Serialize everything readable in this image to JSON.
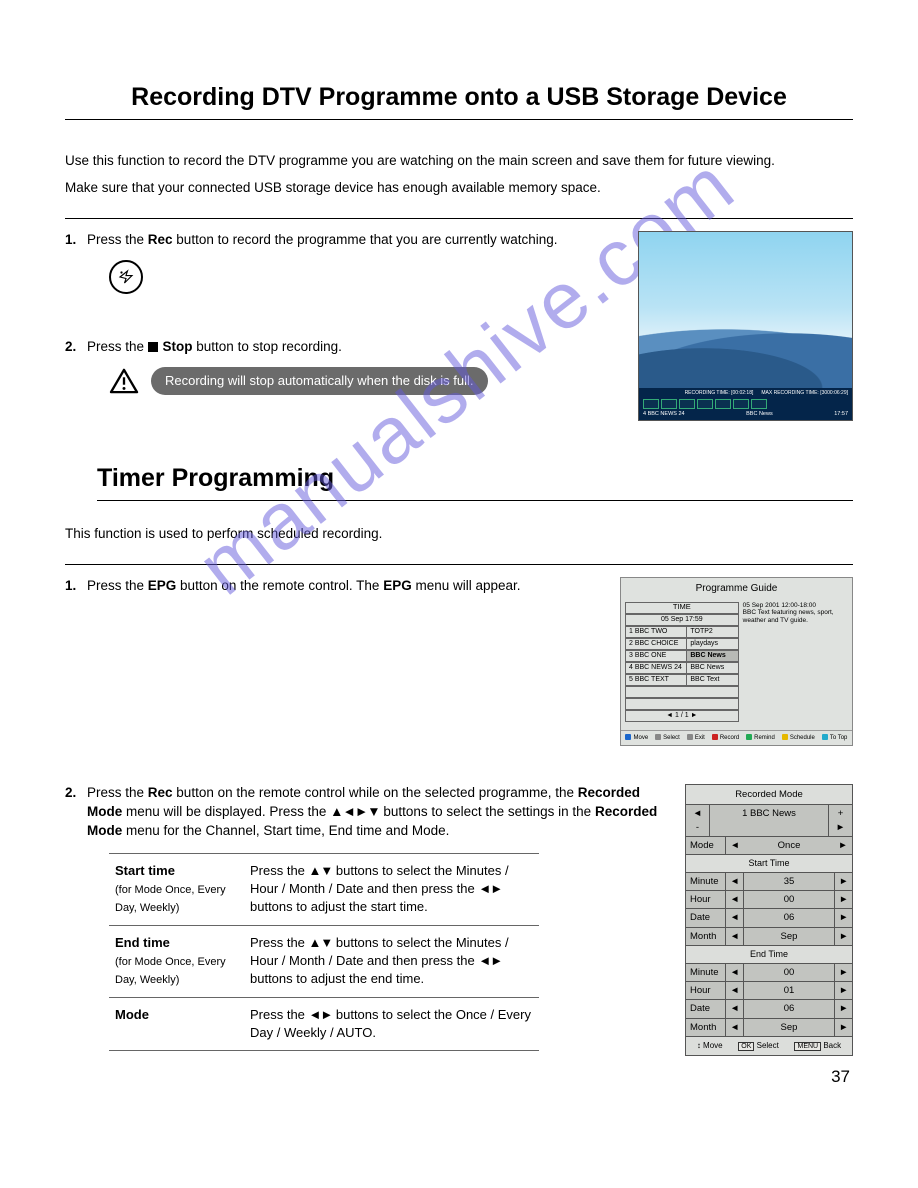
{
  "watermark": "manualshive.com",
  "title1": "Recording DTV Programme onto a USB Storage Device",
  "intro1": "Use this function to record the DTV programme you are watching on the main screen and save them for future viewing.",
  "intro2": "Make sure that your connected USB storage device has enough available memory space.",
  "step1_pre": "Press the ",
  "step1_bold": "Rec",
  "step1_post": " button to record the programme that you are currently watching.",
  "step2_pre": "Press the ",
  "step2_bold": " Stop",
  "step2_post": " button to stop recording.",
  "warning": "Recording will stop automatically when the disk is full.",
  "tv": {
    "rec_time_label": "RECORDING TIME: [00:02:18]",
    "max_time_label": "MAX RECORDING TIME: [3000:06:29]",
    "channel": "4 BBC NEWS 24",
    "prog": "BBC News",
    "time": "17:57"
  },
  "title2": "Timer Programming",
  "intro3": "This function is used to perform scheduled recording.",
  "step3_pre": "Press the ",
  "step3_b1": "EPG",
  "step3_mid": " button on the remote control. The ",
  "step3_b2": "EPG",
  "step3_post": " menu will appear.",
  "epg": {
    "title": "Programme Guide",
    "time_hdr": "TIME",
    "date": "05 Sep   17:59",
    "info_date": "05 Sep 2001       12:00-18:00",
    "info_desc": "BBC Text featuring news, sport, weather and TV guide.",
    "rows": [
      {
        "ch": "1 BBC TWO",
        "pr": "TOTP2"
      },
      {
        "ch": "2 BBC CHOICE",
        "pr": "playdays"
      },
      {
        "ch": "3 BBC ONE",
        "pr": "BBC News"
      },
      {
        "ch": "4 BBC NEWS 24",
        "pr": "BBC News"
      },
      {
        "ch": "5 BBC TEXT",
        "pr": "BBC Text"
      }
    ],
    "page": "◄   1 / 1   ►",
    "legend": [
      {
        "c": "#1a66cc",
        "t": "Move"
      },
      {
        "c": "#888",
        "t": "Select"
      },
      {
        "c": "#888",
        "t": "Exit"
      },
      {
        "c": "#cc2222",
        "t": "Record"
      },
      {
        "c": "#22aa55",
        "t": "Remind"
      },
      {
        "c": "#e6b800",
        "t": "Schedule"
      },
      {
        "c": "#22aacc",
        "t": "To Top"
      }
    ]
  },
  "step4_pre": "Press the ",
  "step4_b1": "Rec",
  "step4_mid1": " button on the remote control while on the selected programme, the ",
  "step4_b2": "Recorded Mode",
  "step4_mid2": " menu will be displayed. Press the ",
  "step4_tri": "▲◄►▼",
  "step4_mid3": " buttons to select the settings in the ",
  "step4_b3": "Recorded Mode",
  "step4_post": " menu for the Channel, Start time, End time and Mode.",
  "settings": [
    {
      "label": "Start time",
      "sub": "(for Mode Once, Every Day, Weekly)",
      "desc_pre": "Press the ",
      "tri1": "▲▼",
      "desc_mid": " buttons to select the Minutes / Hour / Month / Date and then press the ",
      "tri2": "◄►",
      "desc_post": " buttons to adjust the start time."
    },
    {
      "label": "End time",
      "sub": "(for Mode Once, Every Day, Weekly)",
      "desc_pre": "Press the ",
      "tri1": "▲▼",
      "desc_mid": " buttons to select the Minutes / Hour / Month / Date and then press the ",
      "tri2": "◄►",
      "desc_post": " buttons to adjust the end time."
    },
    {
      "label": "Mode",
      "sub": "",
      "desc_pre": "Press the ",
      "tri1": "◄►",
      "desc_mid": " buttons to select the Once / Every Day / Weekly /",
      "tri2": "",
      "desc_post": "AUTO."
    }
  ],
  "rmode": {
    "title": "Recorded Mode",
    "ch_minus": "◄ -",
    "ch_name": "1 BBC News",
    "ch_plus": "+ ►",
    "mode_label": "Mode",
    "mode_val": "Once",
    "start_hdr": "Start Time",
    "end_hdr": "End Time",
    "start": [
      {
        "l": "Minute",
        "v": "35"
      },
      {
        "l": "Hour",
        "v": "00"
      },
      {
        "l": "Date",
        "v": "06"
      },
      {
        "l": "Month",
        "v": "Sep"
      }
    ],
    "end": [
      {
        "l": "Minute",
        "v": "00"
      },
      {
        "l": "Hour",
        "v": "01"
      },
      {
        "l": "Date",
        "v": "06"
      },
      {
        "l": "Month",
        "v": "Sep"
      }
    ],
    "footer_move_icon": "↕",
    "footer_move": "Move",
    "footer_ok": "OK",
    "footer_select": "Select",
    "footer_menu": "MENU",
    "footer_back": "Back"
  },
  "page_num": "37"
}
